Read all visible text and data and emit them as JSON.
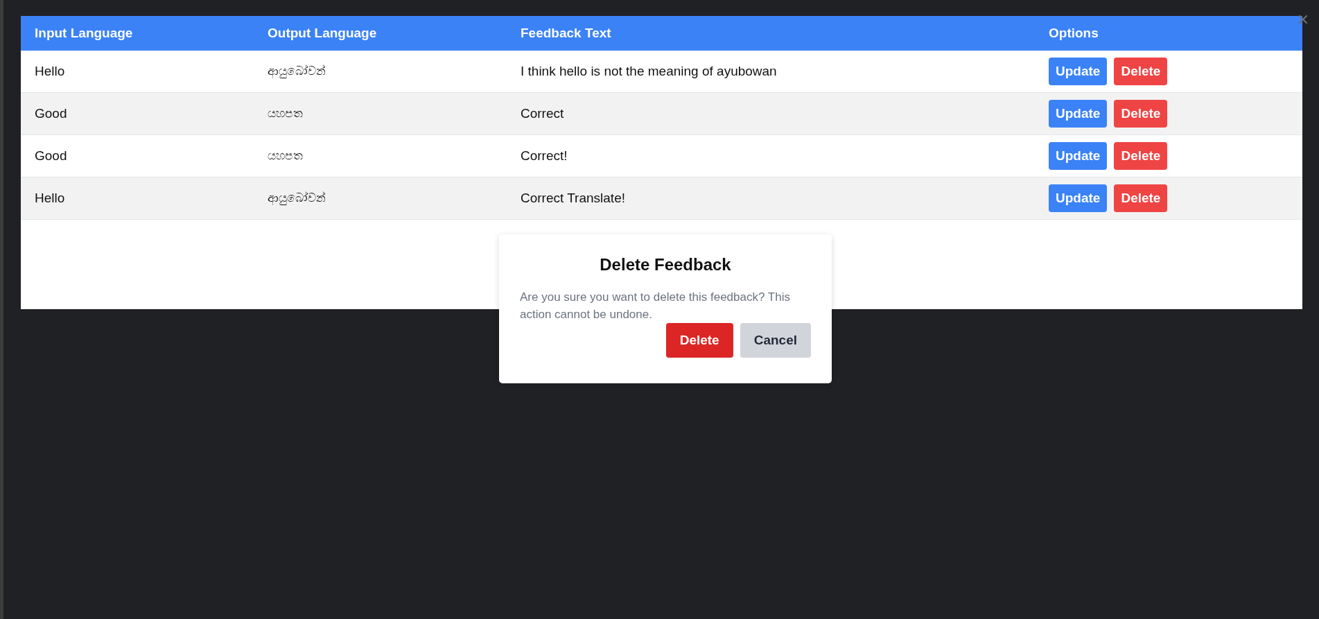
{
  "table": {
    "columns": [
      "Input Language",
      "Output Language",
      "Feedback Text",
      "Options"
    ],
    "rows": [
      {
        "input": "Hello",
        "output": "ආයුබෝවන්",
        "feedback": "I think hello is not the meaning of ayubowan",
        "actions": [
          "Update",
          "Delete"
        ]
      },
      {
        "input": "Good",
        "output": "යහපත",
        "feedback": "Correct",
        "actions": [
          "Update",
          "Delete"
        ]
      },
      {
        "input": "Good",
        "output": "යහපත",
        "feedback": "Correct!",
        "actions": [
          "Update",
          "Delete"
        ]
      },
      {
        "input": "Hello",
        "output": "ආයුබෝවන්",
        "feedback": "Correct Translate!",
        "actions": [
          "Update",
          "Delete"
        ]
      }
    ]
  },
  "dialog": {
    "title": "Delete Feedback",
    "message": "Are you sure you want to delete this feedback? This action cannot be undone.",
    "buttons": [
      {
        "label": "Delete",
        "kind": "danger"
      },
      {
        "label": "Cancel",
        "kind": "secondary"
      }
    ]
  }
}
